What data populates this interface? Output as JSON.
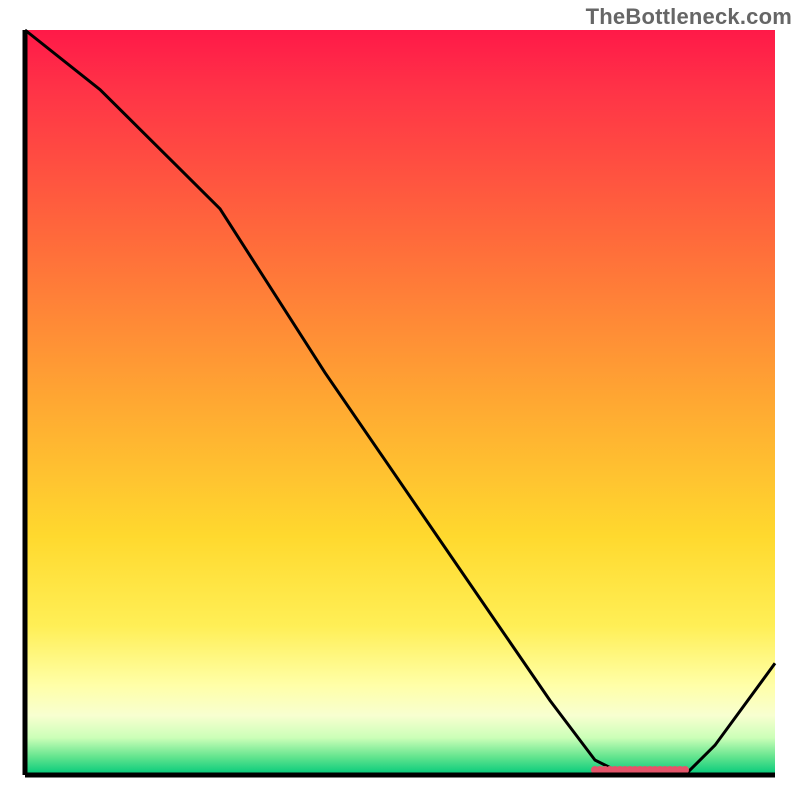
{
  "watermark": "TheBottleneck.com",
  "chart_data": {
    "type": "line",
    "title": "",
    "xlabel": "",
    "ylabel": "",
    "xlim": [
      0,
      100
    ],
    "ylim": [
      0,
      100
    ],
    "grid": false,
    "series": [
      {
        "name": "curve",
        "x": [
          0,
          10,
          20,
          26,
          40,
          55,
          70,
          76,
          80,
          84,
          88,
          92,
          100
        ],
        "values": [
          100,
          92,
          82,
          76,
          54,
          32,
          10,
          2,
          0,
          0,
          0,
          4,
          15
        ]
      }
    ],
    "highlight_segment": {
      "x_start": 76,
      "x_end": 88,
      "y": 0,
      "color": "#e4556a"
    },
    "gradient_stops": [
      {
        "pos": 0,
        "color": "#ff1948"
      },
      {
        "pos": 28,
        "color": "#ff6a3b"
      },
      {
        "pos": 50,
        "color": "#ffa832"
      },
      {
        "pos": 68,
        "color": "#ffd92e"
      },
      {
        "pos": 88,
        "color": "#ffffa8"
      },
      {
        "pos": 97,
        "color": "#66e58f"
      },
      {
        "pos": 100,
        "color": "#00c97a"
      }
    ]
  }
}
